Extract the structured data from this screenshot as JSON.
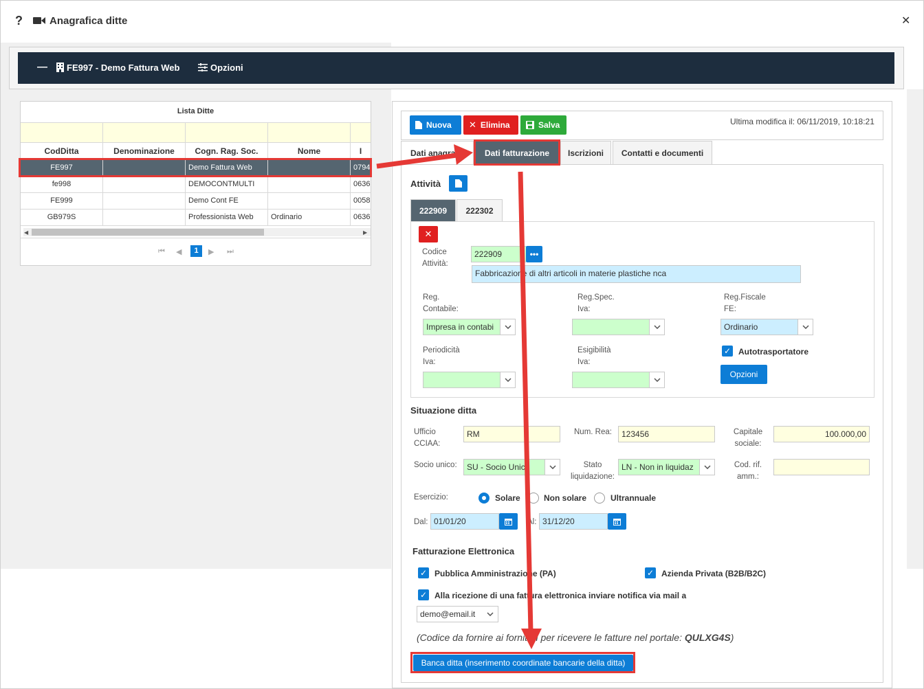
{
  "window": {
    "title": "Anagrafica ditte",
    "help_label": "?",
    "close_label": "✕"
  },
  "header": {
    "collapse_label": "—",
    "company": "FE997 - Demo Fattura Web",
    "options_label": "Opzioni"
  },
  "grid": {
    "title": "Lista Ditte",
    "columns": [
      "CodDitta",
      "Denominazione",
      "Cogn. Rag. Soc.",
      "Nome",
      "I"
    ],
    "rows": [
      [
        "FE997",
        "",
        "Demo Fattura Web",
        "",
        "0794"
      ],
      [
        "fe998",
        "",
        "DEMOCONTMULTI",
        "",
        "0636"
      ],
      [
        "FE999",
        "",
        "Demo Cont FE",
        "",
        "0058"
      ],
      [
        "GB979S",
        "",
        "Professionista Web",
        "Ordinario",
        "0636"
      ]
    ],
    "page": "1"
  },
  "toolbar": {
    "new_label": "Nuova",
    "delete_label": "Elimina",
    "save_label": "Salva",
    "last_modified": "Ultima modifica il: 06/11/2019, 10:18:21"
  },
  "tabs": [
    {
      "label": "Dati anagrafici"
    },
    {
      "label": "Dati fatturazione"
    },
    {
      "label": "Iscrizioni"
    },
    {
      "label": "Contatti e documenti"
    }
  ],
  "activity": {
    "title": "Attività",
    "subtabs": [
      "222909",
      "222302"
    ],
    "code_label": "Codice Attività:",
    "code_value": "222909",
    "description": "Fabbricazione di altri articoli in materie plastiche nca",
    "reg_contabile_label": "Reg. Contabile:",
    "reg_contabile_value": "Impresa in contabi",
    "reg_spec_label": "Reg.Spec. Iva:",
    "reg_spec_value": "",
    "reg_fiscale_label": "Reg.Fiscale FE:",
    "reg_fiscale_value": "Ordinario",
    "periodicita_label": "Periodicità Iva:",
    "esigibilita_label": "Esigibilità Iva:",
    "autotrasportatore_label": "Autotrasportatore",
    "options_button": "Opzioni"
  },
  "situation": {
    "title": "Situazione ditta",
    "ufficio_label": "Ufficio CCIAA:",
    "ufficio_value": "RM",
    "num_rea_label": "Num. Rea:",
    "num_rea_value": "123456",
    "capitale_label": "Capitale sociale:",
    "capitale_value": "100.000,00",
    "socio_label": "Socio unico:",
    "socio_value": "SU - Socio Unico",
    "stato_label": "Stato liquidazione:",
    "stato_value": "LN - Non in liquidaz",
    "cod_rif_label": "Cod. rif. amm.:",
    "esercizio_label": "Esercizio:",
    "solare": "Solare",
    "non_solare": "Non solare",
    "ultrannuale": "Ultrannuale",
    "dal_label": "Dal:",
    "dal_value": "01/01/20",
    "al_label": "Al:",
    "al_value": "31/12/20"
  },
  "einvoice": {
    "title": "Fatturazione Elettronica",
    "pa_label": "Pubblica Amministrazione (PA)",
    "b2b_label": "Azienda Privata (B2B/B2C)",
    "notify_label": "Alla ricezione di una fattura elettronica inviare notifica via mail a",
    "email": "demo@email.it",
    "portal_note": "(Codice da fornire ai fornitori per ricevere le fatture nel portale: ",
    "portal_code": "QULXG4S",
    "portal_close": ")",
    "bank_button": "Banca ditta (inserimento coordinate bancarie della ditta)"
  },
  "colors": {
    "accent": "#0d7dd6",
    "danger": "#e02020",
    "success": "#2eaa3a",
    "header_dark": "#1d2d3e",
    "arrow": "#e53935"
  }
}
